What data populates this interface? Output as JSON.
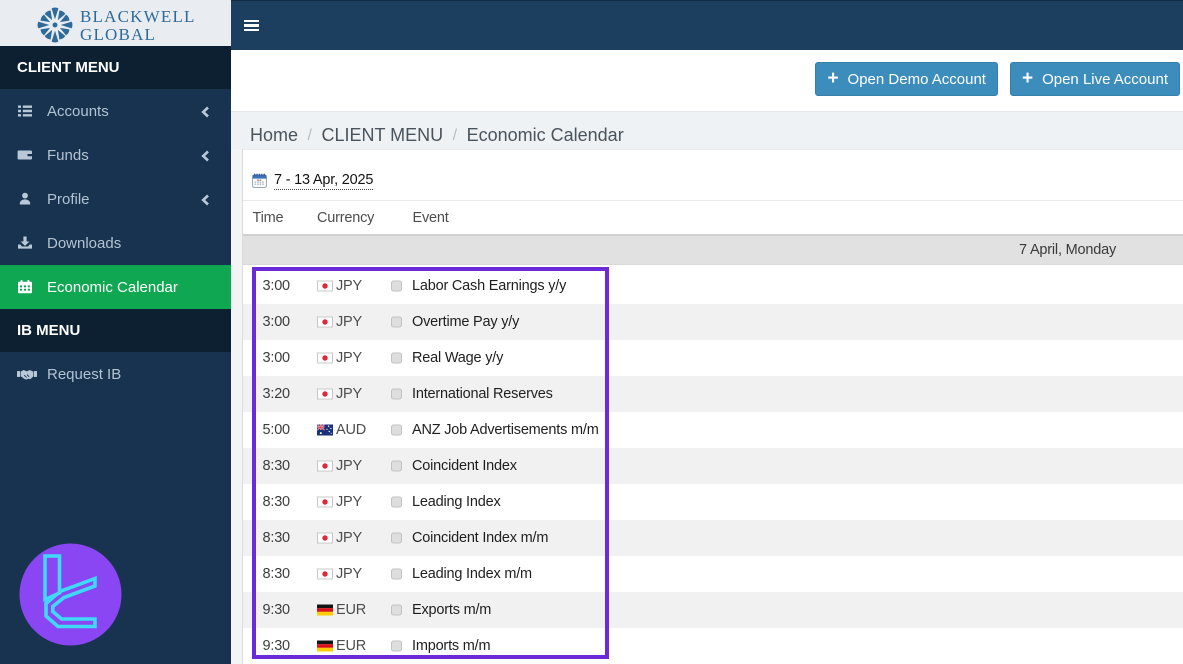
{
  "logo": {
    "line1": "BLACKWELL",
    "line2": "GLOBAL",
    "icon": "starburst-icon",
    "color": "#2e6b9a"
  },
  "sidebar": {
    "sections": [
      {
        "header": "CLIENT MENU",
        "items": [
          {
            "label": "Accounts",
            "icon": "list-icon",
            "chevron": true,
            "active": false
          },
          {
            "label": "Funds",
            "icon": "wallet-icon",
            "chevron": true,
            "active": false
          },
          {
            "label": "Profile",
            "icon": "user-icon",
            "chevron": true,
            "active": false
          },
          {
            "label": "Downloads",
            "icon": "download-icon",
            "chevron": false,
            "active": false
          },
          {
            "label": "Economic Calendar",
            "icon": "calendar-icon",
            "chevron": false,
            "active": true
          }
        ]
      },
      {
        "header": "IB MENU",
        "items": [
          {
            "label": "Request IB",
            "icon": "handshake-icon",
            "chevron": false,
            "active": false
          }
        ]
      }
    ],
    "active_color": "#0fa751"
  },
  "navbar": {
    "menu_toggle_icon": "hamburger-icon",
    "background": "#1c3e5f"
  },
  "toolbar": {
    "buttons": [
      {
        "label": "Open Demo Account",
        "icon": "plus-icon"
      },
      {
        "label": "Open Live Account",
        "icon": "plus-icon"
      }
    ],
    "button_color": "#3c8dbc"
  },
  "breadcrumb": {
    "items": [
      "Home",
      "CLIENT MENU",
      "Economic Calendar"
    ],
    "separator": "/"
  },
  "calendar": {
    "date_range": "7 - 13 Apr, 2025",
    "date_icon": "datepicker-icon",
    "columns": [
      "Time",
      "Currency",
      "Event"
    ],
    "day_label": "7 April, Monday",
    "row_checkbox_icon": "checkbox-icon",
    "rows": [
      {
        "time": "3:00",
        "currency": "JPY",
        "flag": "jp",
        "event": "Labor Cash Earnings y/y"
      },
      {
        "time": "3:00",
        "currency": "JPY",
        "flag": "jp",
        "event": "Overtime Pay y/y"
      },
      {
        "time": "3:00",
        "currency": "JPY",
        "flag": "jp",
        "event": "Real Wage y/y"
      },
      {
        "time": "3:20",
        "currency": "JPY",
        "flag": "jp",
        "event": "International Reserves"
      },
      {
        "time": "5:00",
        "currency": "AUD",
        "flag": "au",
        "event": "ANZ Job Advertisements m/m"
      },
      {
        "time": "8:30",
        "currency": "JPY",
        "flag": "jp",
        "event": "Coincident Index"
      },
      {
        "time": "8:30",
        "currency": "JPY",
        "flag": "jp",
        "event": "Leading Index"
      },
      {
        "time": "8:30",
        "currency": "JPY",
        "flag": "jp",
        "event": "Coincident Index m/m"
      },
      {
        "time": "8:30",
        "currency": "JPY",
        "flag": "jp",
        "event": "Leading Index m/m"
      },
      {
        "time": "9:30",
        "currency": "EUR",
        "flag": "de",
        "event": "Exports m/m"
      },
      {
        "time": "9:30",
        "currency": "EUR",
        "flag": "de",
        "event": "Imports m/m"
      }
    ]
  },
  "annotation": {
    "type": "highlight-rectangle",
    "color": "#6c2bd9"
  },
  "watermark": {
    "icon": "neon-glyph-badge",
    "circle_color": "#8a46f2",
    "glyph_color": "#3fd9fb"
  }
}
